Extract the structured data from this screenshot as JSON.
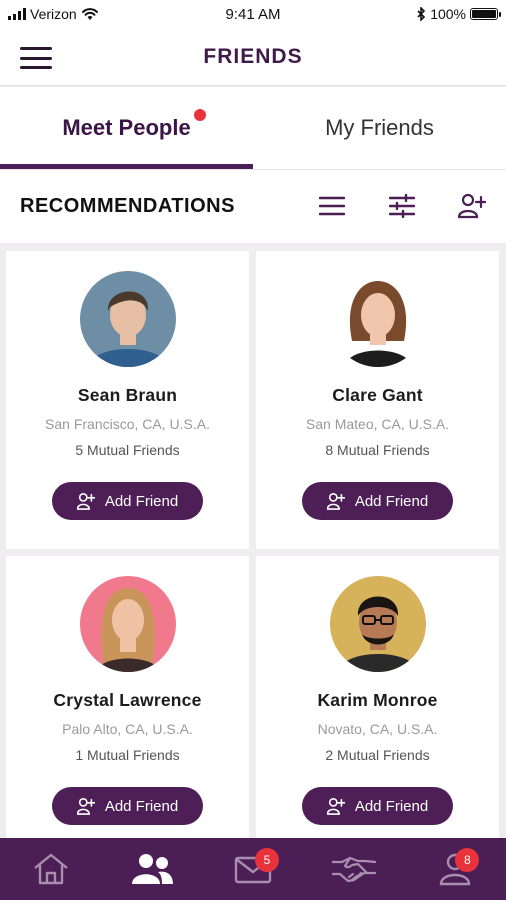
{
  "status_bar": {
    "carrier": "Verizon",
    "time": "9:41 AM",
    "battery": "100%",
    "battery_level": 1.0
  },
  "header": {
    "title": "FRIENDS",
    "menu_icon": "hamburger-menu-icon"
  },
  "tabs": [
    {
      "label": "Meet People",
      "active": true,
      "has_notification": true
    },
    {
      "label": "My Friends",
      "active": false,
      "has_notification": false
    }
  ],
  "recommendations": {
    "title": "RECOMMENDATIONS",
    "icons": [
      "list-view-icon",
      "filter-sliders-icon",
      "add-person-icon"
    ]
  },
  "people": [
    {
      "name": "Sean Braun",
      "location": "San Francisco, CA, U.S.A.",
      "mutual": "5 Mutual Friends",
      "button": "Add Friend",
      "avatar_bg": "#6e8ea6",
      "skin": "#e6bfa5",
      "hair": "#4a3a2c",
      "shirt": "#2f5f8c"
    },
    {
      "name": "Clare Gant",
      "location": "San Mateo, CA, U.S.A.",
      "mutual": "8 Mutual Friends",
      "button": "Add Friend",
      "avatar_bg": "#ffffff",
      "skin": "#f0c7ad",
      "hair": "#7a4a2c",
      "shirt": "#1d1d1d"
    },
    {
      "name": "Crystal Lawrence",
      "location": "Palo Alto, CA, U.S.A.",
      "mutual": "1 Mutual Friends",
      "button": "Add Friend",
      "avatar_bg": "#f07a8c",
      "skin": "#f1c3a5",
      "hair": "#c9955a",
      "shirt": "#3a2a2a"
    },
    {
      "name": "Karim Monroe",
      "location": "Novato, CA, U.S.A.",
      "mutual": "2 Mutual Friends",
      "button": "Add Friend",
      "avatar_bg": "#d6b35a",
      "skin": "#b67a55",
      "hair": "#1a1512",
      "shirt": "#2a2a2a"
    }
  ],
  "bottom_nav": [
    {
      "icon": "home-icon",
      "badge": "",
      "active": false
    },
    {
      "icon": "friends-icon",
      "badge": "",
      "active": true
    },
    {
      "icon": "mail-icon",
      "badge": "5",
      "active": false
    },
    {
      "icon": "handshake-icon",
      "badge": "",
      "active": false
    },
    {
      "icon": "profile-icon",
      "badge": "8",
      "active": false
    }
  ],
  "colors": {
    "brand": "#4b1e55",
    "badge": "#e8323c",
    "active_nav_icon": "#ffffff",
    "inactive_nav_icon": "#a88fae"
  }
}
